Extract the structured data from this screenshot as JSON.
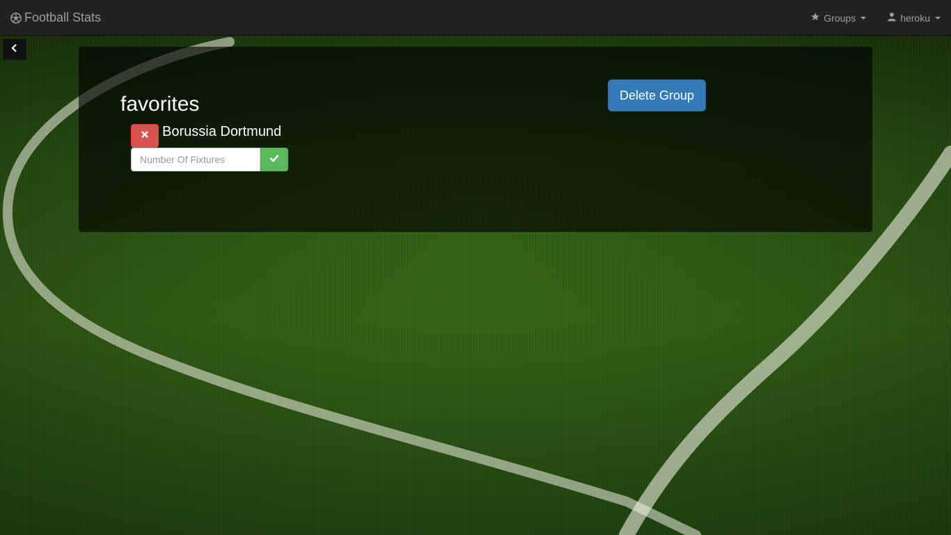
{
  "navbar": {
    "brand": "Football Stats",
    "brand_icon": "soccer-ball-icon",
    "groups_label": "Groups",
    "groups_icon": "star-icon",
    "user_label": "heroku",
    "user_icon": "user-icon"
  },
  "back_button": {
    "icon": "chevron-left-icon"
  },
  "group": {
    "title": "favorites",
    "delete_label": "Delete Group",
    "teams": [
      {
        "name": "Borussia Dortmund",
        "remove_icon": "close-icon",
        "fixtures_placeholder": "Number Of Fixtures",
        "fixtures_value": "",
        "confirm_icon": "check-icon"
      }
    ]
  },
  "colors": {
    "navbar_bg": "#222222",
    "navbar_text": "#9d9d9d",
    "primary": "#337ab7",
    "danger": "#d9534f",
    "success": "#5cb85c"
  }
}
